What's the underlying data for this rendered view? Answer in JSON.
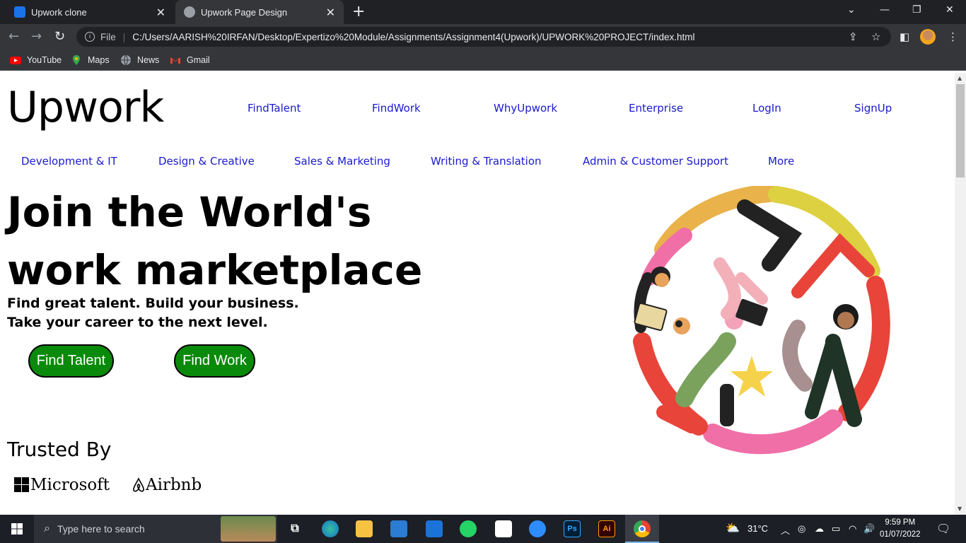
{
  "browser": {
    "tabs": [
      {
        "title": "Upwork clone",
        "active": false
      },
      {
        "title": "Upwork Page Design",
        "active": true
      }
    ],
    "address": {
      "scheme_label": "File",
      "url": "C:/Users/AARISH%20IRFAN/Desktop/Expertizo%20Module/Assignments/Assignment4(Upwork)/UPWORK%20PROJECT/index.html"
    },
    "bookmarks": [
      "YouTube",
      "Maps",
      "News",
      "Gmail"
    ]
  },
  "page": {
    "logo": "Upwork",
    "top_nav": [
      "FindTalent",
      "FindWork",
      "WhyUpwork",
      "Enterprise",
      "LogIn",
      "SignUp"
    ],
    "categories": [
      "Development & IT",
      "Design & Creative",
      "Sales & Marketing",
      "Writing & Translation",
      "Admin & Customer Support",
      "More"
    ],
    "hero": {
      "title_line1": "Join the World's",
      "title_line2": "work marketplace",
      "subtitle_line1": "Find great talent. Build your business.",
      "subtitle_line2": "Take your career to the next level."
    },
    "buttons": {
      "find_talent": "Find Talent",
      "find_work": "Find Work"
    },
    "trusted": {
      "heading": "Trusted By",
      "brands": [
        "Microsoft",
        "Airbnb"
      ]
    },
    "colors": {
      "button_green": "#0a8a0a",
      "nav_link": "#1a1acc"
    }
  },
  "taskbar": {
    "search_placeholder": "Type here to search",
    "weather": "31°C",
    "time": "9:59 PM",
    "date": "01/07/2022",
    "apps": [
      "task-view",
      "edge",
      "file-explorer",
      "store",
      "mail",
      "whatsapp",
      "notepad",
      "zoom",
      "photoshop",
      "illustrator",
      "chrome"
    ],
    "ps_label": "Ps",
    "ai_label": "Ai"
  }
}
